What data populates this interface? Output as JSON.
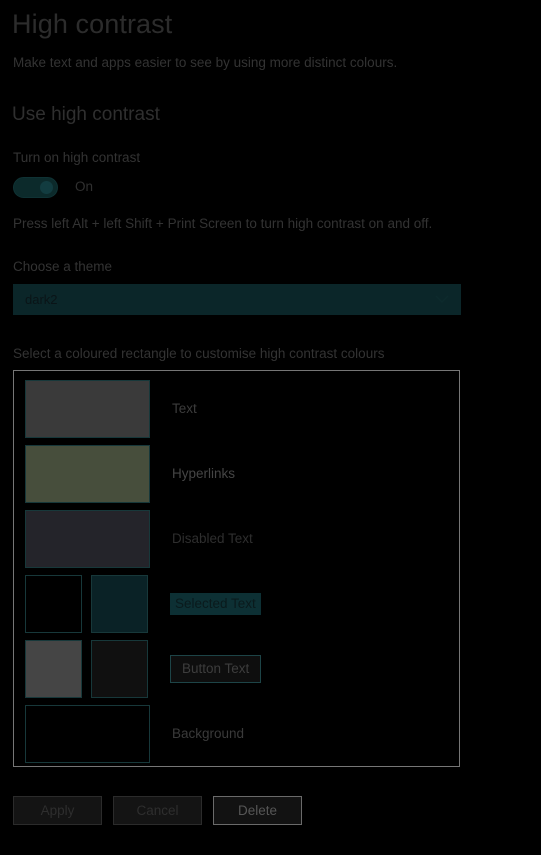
{
  "page": {
    "title": "High contrast",
    "subtitle": "Make text and apps easier to see by using more distinct colours.",
    "section_heading": "Use high contrast"
  },
  "toggle": {
    "label": "Turn on high contrast",
    "state": "On",
    "hint": "Press left Alt + left Shift + Print Screen to turn high contrast on and off."
  },
  "theme": {
    "label": "Choose a theme",
    "selected": "dark2",
    "chevron_icon": "chevron-down-icon"
  },
  "swatches": {
    "hint": "Select a coloured rectangle to customise high contrast colours",
    "rows": [
      {
        "label": "Text",
        "style": "plain",
        "colors": [
          "#3a3a3a"
        ]
      },
      {
        "label": "Hyperlinks",
        "style": "plain",
        "colors": [
          "#474e3c"
        ]
      },
      {
        "label": "Disabled Text",
        "style": "plain",
        "colors": [
          "#24242a"
        ]
      },
      {
        "label": "Selected Text",
        "style": "chip-selected",
        "colors": [
          "#000000",
          "#0a2226"
        ]
      },
      {
        "label": "Button Text",
        "style": "chip-button",
        "colors": [
          "#454545",
          "#101010"
        ]
      },
      {
        "label": "Background",
        "style": "plain",
        "colors": [
          "#000000"
        ]
      }
    ]
  },
  "actions": {
    "apply": "Apply",
    "cancel": "Cancel",
    "delete": "Delete"
  },
  "colors": {
    "accent_teal": "#0b2629",
    "swatch_border": "#17383a",
    "container_border": "#767676"
  }
}
